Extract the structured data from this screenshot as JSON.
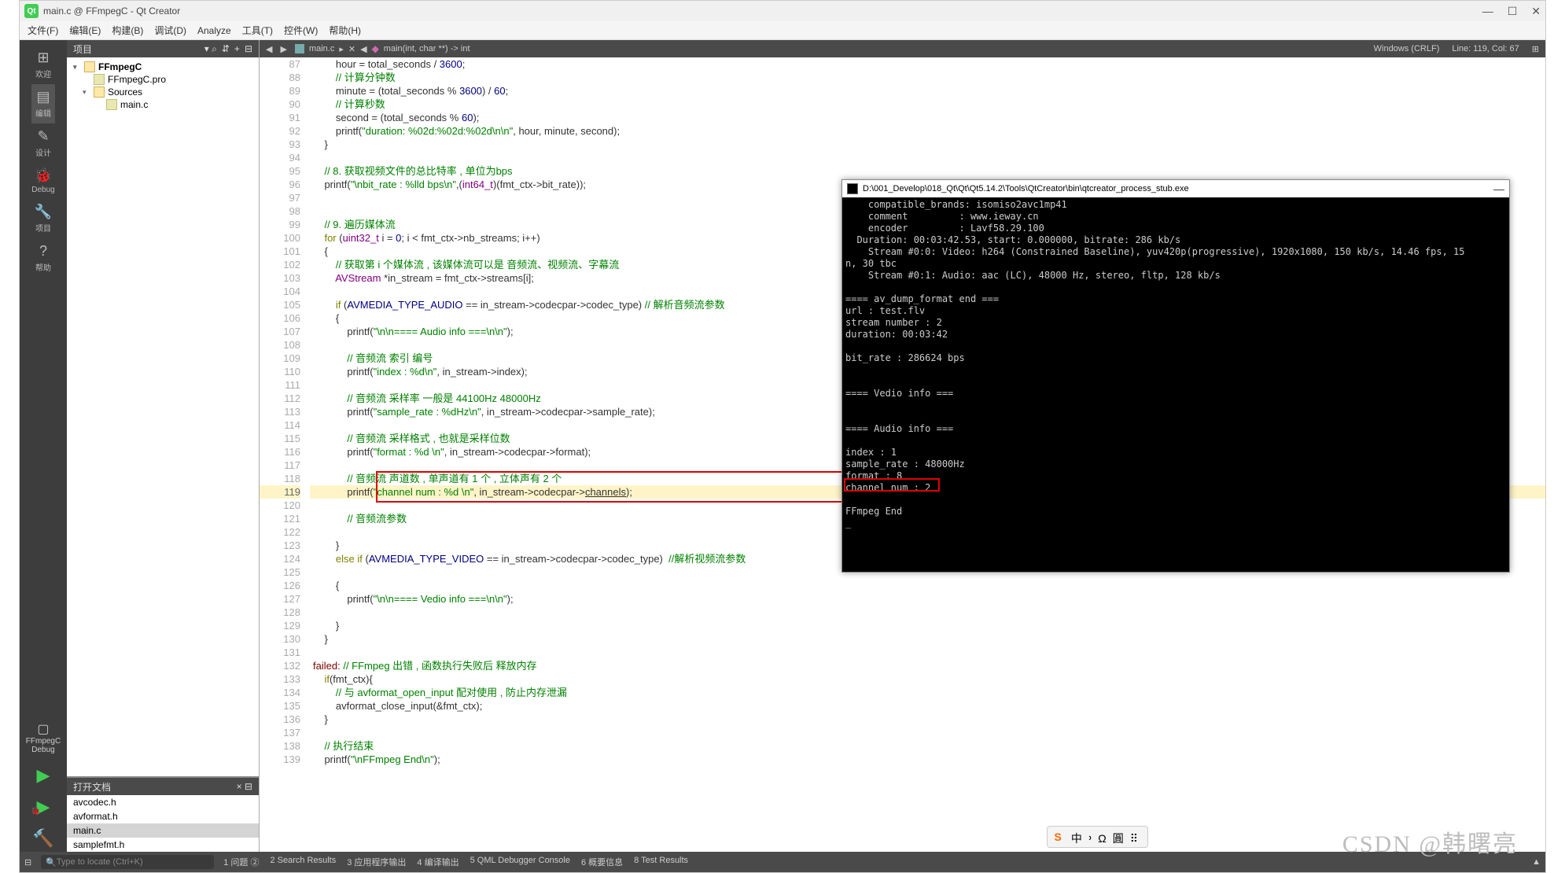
{
  "title": "main.c @ FFmpegC - Qt Creator",
  "menus": [
    "文件(F)",
    "编辑(E)",
    "构建(B)",
    "调试(D)",
    "Analyze",
    "工具(T)",
    "控件(W)",
    "帮助(H)"
  ],
  "modes": [
    {
      "icon": "⊞",
      "label": "欢迎"
    },
    {
      "icon": "▤",
      "label": "编辑",
      "active": true
    },
    {
      "icon": "✎",
      "label": "设计"
    },
    {
      "icon": "🐞",
      "label": "Debug"
    },
    {
      "icon": "🔧",
      "label": "项目"
    },
    {
      "icon": "?",
      "label": "帮助"
    }
  ],
  "kit_name": "FFmpegC",
  "kit_mode": "Debug",
  "project_header": "项目",
  "project_tree": [
    {
      "d": 0,
      "arr": "▾",
      "ico": "folder",
      "label": "FFmpegC",
      "bold": true
    },
    {
      "d": 1,
      "arr": "",
      "ico": "file",
      "label": "FFmpegC.pro"
    },
    {
      "d": 1,
      "arr": "▾",
      "ico": "folder",
      "label": "Sources"
    },
    {
      "d": 2,
      "arr": "",
      "ico": "file",
      "label": "main.c"
    }
  ],
  "open_docs_header": "打开文档",
  "open_docs": [
    {
      "name": "avcodec.h"
    },
    {
      "name": "avformat.h"
    },
    {
      "name": "main.c",
      "sel": true
    },
    {
      "name": "samplefmt.h"
    }
  ],
  "editor_file": "main.c",
  "editor_func": "main(int, char **) -> int",
  "line_col": "Line: 119, Col: 67",
  "encoding": "Windows (CRLF)",
  "code_start": 87,
  "code": [
    {
      "t": "        hour = total_seconds / <span class='num'>3600</span>;"
    },
    {
      "t": "        <span class='cmt'>// 计算分钟数</span>"
    },
    {
      "t": "        minute = (total_seconds % <span class='num'>3600</span>) / <span class='num'>60</span>;"
    },
    {
      "t": "        <span class='cmt'>// 计算秒数</span>"
    },
    {
      "t": "        second = (total_seconds % <span class='num'>60</span>);"
    },
    {
      "t": "        printf(<span class='str'>\"duration: %02d:%02d:%02d\\n\\n\"</span>, hour, minute, second);"
    },
    {
      "t": "    }"
    },
    {
      "t": ""
    },
    {
      "t": "    <span class='cmt'>// 8. 获取视频文件的总比特率 , 单位为bps</span>"
    },
    {
      "t": "    printf(<span class='str'>\"\\nbit_rate : %lld bps\\n\"</span>,(<span class='ty'>int64_t</span>)(fmt_ctx-&gt;bit_rate));"
    },
    {
      "t": ""
    },
    {
      "t": ""
    },
    {
      "t": "    <span class='cmt'>// 9. 遍历媒体流</span>"
    },
    {
      "t": "    <span class='kw'>for</span> (<span class='ty'>uint32_t</span> i = <span class='num'>0</span>; i &lt; fmt_ctx-&gt;nb_streams; i++)"
    },
    {
      "t": "    {"
    },
    {
      "t": "        <span class='cmt'>// 获取第 i 个媒体流 , 该媒体流可以是 音频流、视频流、字幕流</span>"
    },
    {
      "t": "        <span class='ty'>AVStream</span> *in_stream = fmt_ctx-&gt;streams[i];"
    },
    {
      "t": ""
    },
    {
      "t": "        <span class='kw'>if</span> (<span class='macro'>AVMEDIA_TYPE_AUDIO</span> == in_stream-&gt;codecpar-&gt;codec_type) <span class='cmt'>// 解析音频流参数</span>"
    },
    {
      "t": "        {"
    },
    {
      "t": "            printf(<span class='str'>\"\\n\\n==== Audio info ===\\n\\n\"</span>);"
    },
    {
      "t": ""
    },
    {
      "t": "            <span class='cmt'>// 音频流 索引 编号</span>"
    },
    {
      "t": "            printf(<span class='str'>\"index : %d\\n\"</span>, in_stream-&gt;index);"
    },
    {
      "t": ""
    },
    {
      "t": "            <span class='cmt'>// 音频流 采样率 一般是 44100Hz 48000Hz</span>"
    },
    {
      "t": "            printf(<span class='str'>\"sample_rate : %dHz\\n\"</span>, in_stream-&gt;codecpar-&gt;sample_rate);"
    },
    {
      "t": ""
    },
    {
      "t": "            <span class='cmt'>// 音频流 采样格式 , 也就是采样位数</span>"
    },
    {
      "t": "            printf(<span class='str'>\"format : %d \\n\"</span>, in_stream-&gt;codecpar-&gt;format);"
    },
    {
      "t": ""
    },
    {
      "t": "            <span class='cmt'>// 音频流 声道数 , 单声道有 1 个 , 立体声有 2 个</span>"
    },
    {
      "t": "            printf(<span class='str'>\"channel num : %d \\n\"</span>, in_stream-&gt;codecpar-&gt;<u>channels</u>);",
      "cur": true
    },
    {
      "t": ""
    },
    {
      "t": "            <span class='cmt'>// 音频流参数</span>"
    },
    {
      "t": ""
    },
    {
      "t": "        }"
    },
    {
      "t": "        <span class='kw'>else if</span> (<span class='macro'>AVMEDIA_TYPE_VIDEO</span> == in_stream-&gt;codecpar-&gt;codec_type)  <span class='cmt'>//解析视频流参数</span>"
    },
    {
      "t": ""
    },
    {
      "t": "        {"
    },
    {
      "t": "            printf(<span class='str'>\"\\n\\n==== Vedio info ===\\n\\n\"</span>);"
    },
    {
      "t": ""
    },
    {
      "t": "        }"
    },
    {
      "t": "    }"
    },
    {
      "t": ""
    },
    {
      "t": "<span class='fail'>failed:</span> <span class='cmt'>// FFmpeg 出错 , 函数执行失败后 释放内存</span>"
    },
    {
      "t": "    <span class='kw'>if</span>(fmt_ctx){"
    },
    {
      "t": "        <span class='cmt'>// 与 avformat_open_input 配对使用 , 防止内存泄漏</span>"
    },
    {
      "t": "        avformat_close_input(&amp;fmt_ctx);"
    },
    {
      "t": "    }"
    },
    {
      "t": ""
    },
    {
      "t": "    <span class='cmt'>// 执行结束</span>"
    },
    {
      "t": "    printf(<span class='str'>\"\\nFFmpeg End\\n\"</span>);"
    }
  ],
  "locator_placeholder": "Type to locate (Ctrl+K)",
  "output_tabs": [
    "1 问题 ②",
    "2 Search Results",
    "3 应用程序输出",
    "4 编译输出",
    "5 QML Debugger Console",
    "6 概要信息",
    "8 Test Results"
  ],
  "console_title": "D:\\001_Develop\\018_Qt\\Qt\\Qt5.14.2\\Tools\\QtCreator\\bin\\qtcreator_process_stub.exe",
  "console_lines": [
    "    compatible_brands: isomiso2avc1mp41",
    "    comment         : www.ieway.cn",
    "    encoder         : Lavf58.29.100",
    "  Duration: 00:03:42.53, start: 0.000000, bitrate: 286 kb/s",
    "    Stream #0:0: Video: h264 (Constrained Baseline), yuv420p(progressive), 1920x1080, 150 kb/s, 14.46 fps, 15",
    "n, 30 tbc",
    "    Stream #0:1: Audio: aac (LC), 48000 Hz, stereo, fltp, 128 kb/s",
    "",
    "==== av_dump_format end ===",
    "url : test.flv",
    "stream number : 2",
    "duration: 00:03:42",
    "",
    "bit_rate : 286624 bps",
    "",
    "",
    "==== Vedio info ===",
    "",
    "",
    "==== Audio info ===",
    "",
    "index : 1",
    "sample_rate : 48000Hz",
    "format : 8",
    "channel num : 2",
    "",
    "FFmpeg End",
    "_"
  ],
  "ime": [
    "中",
    "᠈",
    "Ω",
    "圓",
    "⠿"
  ],
  "watermark": "CSDN @韩曙亮"
}
